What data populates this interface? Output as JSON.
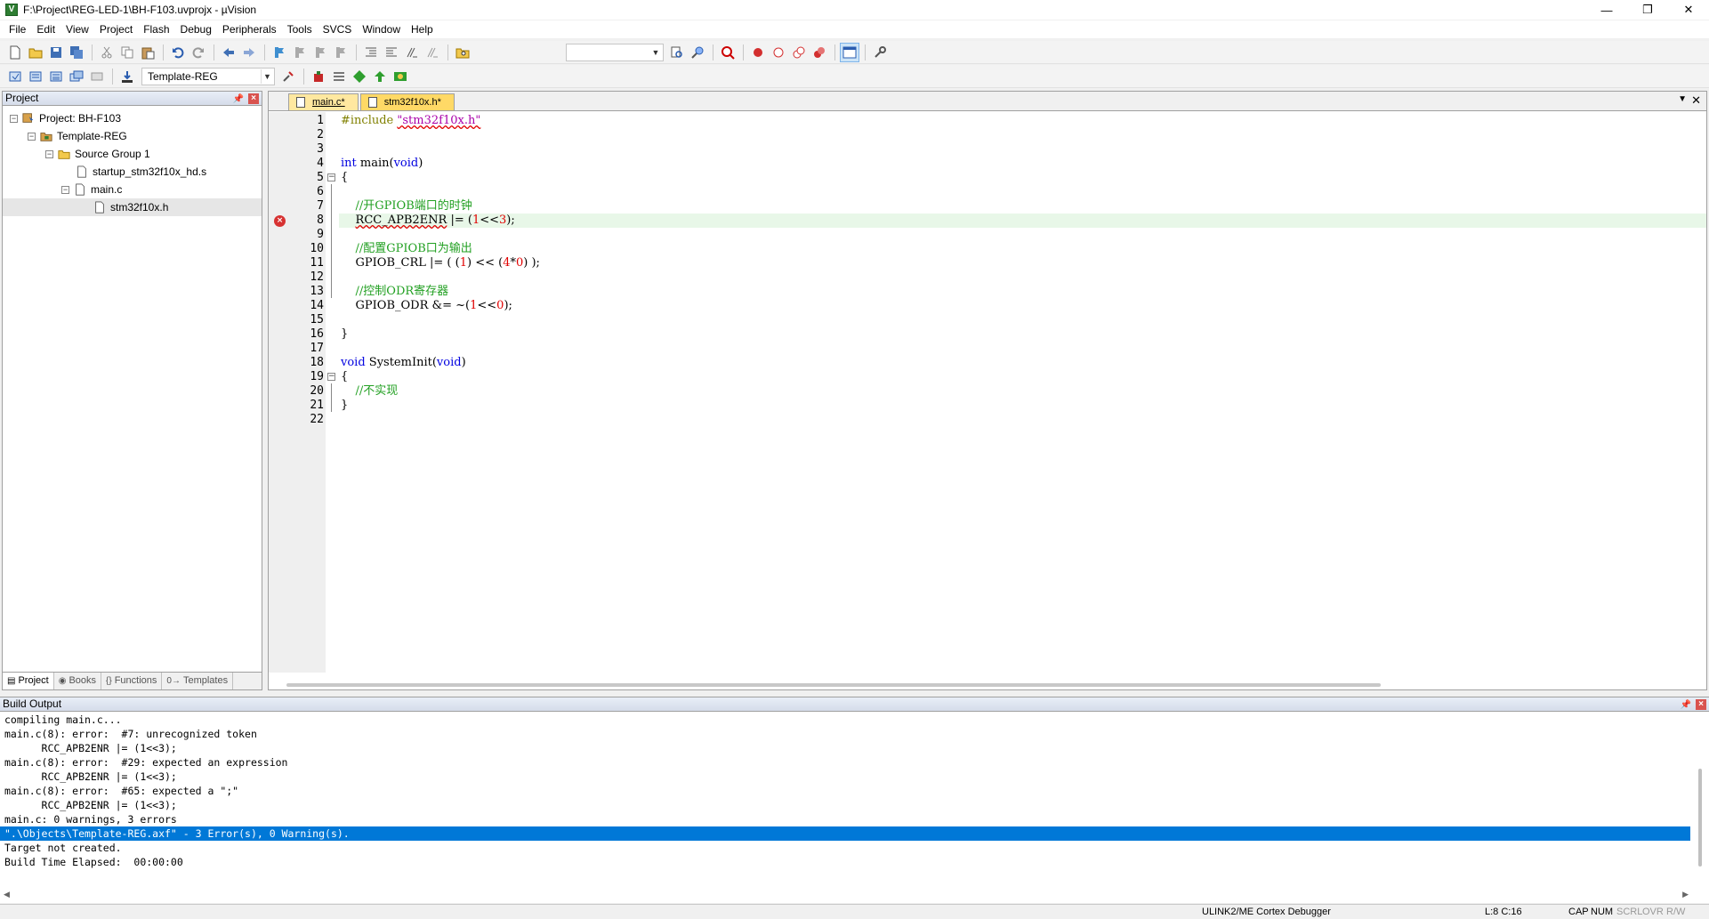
{
  "window": {
    "title": "F:\\Project\\REG-LED-1\\BH-F103.uvprojx - µVision",
    "app_icon": "V",
    "controls": {
      "minimize": "—",
      "maximize": "❐",
      "close": "✕"
    }
  },
  "menu": [
    "File",
    "Edit",
    "View",
    "Project",
    "Flash",
    "Debug",
    "Peripherals",
    "Tools",
    "SVCS",
    "Window",
    "Help"
  ],
  "toolbar2": {
    "target": "Template-REG"
  },
  "project_panel": {
    "title": "Project",
    "tree": {
      "project": "Project: BH-F103",
      "target": "Template-REG",
      "group": "Source Group 1",
      "files": [
        "startup_stm32f10x_hd.s",
        "main.c"
      ],
      "include": "stm32f10x.h"
    },
    "tabs": [
      "Project",
      "Books",
      "Functions",
      "Templates"
    ]
  },
  "editor": {
    "tabs": [
      "main.c*",
      "stm32f10x.h*"
    ],
    "line_numbers": [
      "1",
      "2",
      "3",
      "4",
      "5",
      "6",
      "7",
      "8",
      "9",
      "10",
      "11",
      "12",
      "13",
      "14",
      "15",
      "16",
      "17",
      "18",
      "19",
      "20",
      "21",
      "22"
    ],
    "code": {
      "l1_pp": "#include ",
      "l1_str": "\"stm32f10x.h\"",
      "l4_kw": "int",
      "l4_rest": " main(",
      "l4_kw2": "void",
      "l4_end": ")",
      "l5": "{",
      "l7_cm": "//开GPIOB端口的时钟",
      "l8_a": "RCC_APB2ENR",
      "l8_b": " |= (",
      "l8_n1": "1",
      "l8_c": "<<",
      "l8_n2": "3",
      "l8_d": ");",
      "l10_cm": "//配置GPIOB口为输出",
      "l11_a": "GPIOB_CRL |= ( (",
      "l11_n1": "1",
      "l11_b": ") << (",
      "l11_n2": "4",
      "l11_c": "*",
      "l11_n3": "0",
      "l11_d": ") );",
      "l13_cm": "//控制ODR寄存器",
      "l14_a": "GPIOB_ODR &= ~(",
      "l14_n1": "1",
      "l14_b": "<<",
      "l14_n2": "0",
      "l14_c": ");",
      "l16": "}",
      "l18_kw": "void",
      "l18_rest": " SystemInit(",
      "l18_kw2": "void",
      "l18_end": ")",
      "l19": "{",
      "l20_cm": "//不实现",
      "l21": "}"
    }
  },
  "build_output": {
    "title": "Build Output",
    "lines": [
      "compiling main.c...",
      "main.c(8): error:  #7: unrecognized token",
      "      RCC_APB2ENR |= (1<<3);",
      "main.c(8): error:  #29: expected an expression",
      "      RCC_APB2ENR |= (1<<3);",
      "main.c(8): error:  #65: expected a \";\"",
      "      RCC_APB2ENR |= (1<<3);",
      "main.c: 0 warnings, 3 errors",
      "\".\\Objects\\Template-REG.axf\" - 3 Error(s), 0 Warning(s).",
      "Target not created.",
      "Build Time Elapsed:  00:00:00"
    ],
    "selected_index": 8
  },
  "status": {
    "debugger": "ULINK2/ME Cortex Debugger",
    "position": "L:8 C:16",
    "cap": "CAP",
    "num": "NUM",
    "scrl": "SCRL",
    "ovr": "OVR",
    "rw": "R/W"
  },
  "colors": {
    "accent": "#0078d7",
    "tab_active": "#ffe8a0",
    "error": "#d73232",
    "comment": "#22a022",
    "keyword": "#0000e0"
  }
}
